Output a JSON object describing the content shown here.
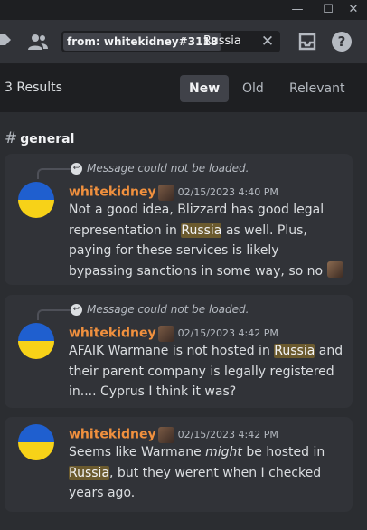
{
  "window_controls": {
    "minimize": "—",
    "maximize": "☐",
    "close": "✕"
  },
  "search": {
    "filter_chip": "from: whitekidney#3118",
    "term": "Russia",
    "clear_icon": "close-icon"
  },
  "results": {
    "count_label": "3 Results",
    "tabs": [
      {
        "label": "New",
        "active": true
      },
      {
        "label": "Old",
        "active": false
      },
      {
        "label": "Relevant",
        "active": false
      }
    ]
  },
  "channel": {
    "hash": "#",
    "name": "general"
  },
  "messages": [
    {
      "reply_text": "Message could not be loaded.",
      "username": "whitekidney",
      "timestamp": "02/15/2023 4:40 PM",
      "body_parts": [
        "Not a good idea, Blizzard has good legal representation in ",
        "Russia",
        " as well. Plus, paying for these services is likely bypassing sanctions in some way, so no"
      ],
      "trailing_emoji": "custom-emoji"
    },
    {
      "reply_text": "Message could not be loaded.",
      "username": "whitekidney",
      "timestamp": "02/15/2023 4:42 PM",
      "body_parts": [
        "AFAIK Warmane is not hosted in ",
        "Russia",
        " and their parent company is legally registered in.... Cyprus I think it was?"
      ]
    },
    {
      "username": "whitekidney",
      "timestamp": "02/15/2023 4:42 PM",
      "body_parts": [
        "Seems like Warmane ",
        "might",
        " be hosted in ",
        "Russia",
        ", but they werent when I checked years ago."
      ]
    }
  ],
  "colors": {
    "username": "#f0903e",
    "highlight": "#6b5a2e",
    "flag_blue": "#1f5fcf",
    "flag_yellow": "#f7d218"
  }
}
